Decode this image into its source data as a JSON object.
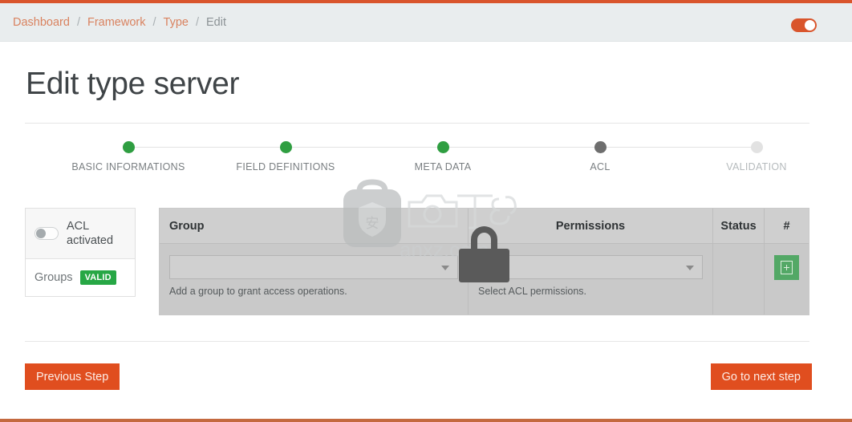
{
  "breadcrumb": {
    "items": [
      {
        "label": "Dashboard",
        "current": false
      },
      {
        "label": "Framework",
        "current": false
      },
      {
        "label": "Type",
        "current": false
      },
      {
        "label": "Edit",
        "current": true
      }
    ],
    "separator": "/"
  },
  "header": {
    "master_toggle_state": "on",
    "accent_color": "#d9552c"
  },
  "page": {
    "title": "Edit type server"
  },
  "stepper": {
    "steps": [
      {
        "label": "BASIC INFORMATIONS",
        "state": "done"
      },
      {
        "label": "FIELD DEFINITIONS",
        "state": "done"
      },
      {
        "label": "META DATA",
        "state": "done"
      },
      {
        "label": "ACL",
        "state": "current"
      },
      {
        "label": "VALIDATION",
        "state": "todo"
      }
    ],
    "done_color": "#2f9e41",
    "current_color": "#6e6e6e",
    "todo_color": "#e2e2e2"
  },
  "sidebar": {
    "acl": {
      "label": "ACL activated",
      "toggle_state": "off"
    },
    "groups": {
      "label": "Groups",
      "badge": "VALID",
      "badge_color": "#27a745"
    }
  },
  "acl_table": {
    "columns": [
      "Group",
      "Permissions",
      "Status",
      "#"
    ],
    "rows": [
      {
        "group_select_value": "",
        "group_helper": "Add a group to grant access operations.",
        "permissions_select_value": "",
        "permissions_helper": "Select ACL permissions.",
        "status": "",
        "action_icon": "add-box-icon"
      }
    ]
  },
  "footer": {
    "previous_label": "Previous Step",
    "next_label": "Go to next step",
    "button_color": "#e04e1f"
  },
  "watermark": {
    "text": "anxz.com",
    "logo_icon": "software-bag-icon",
    "overlay_icon": "padlock-icon"
  }
}
